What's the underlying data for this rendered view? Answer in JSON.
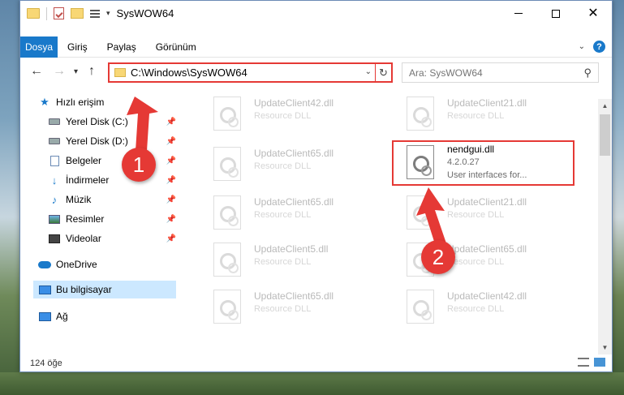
{
  "window": {
    "title": "SysWOW64"
  },
  "ribbon": {
    "tabs": [
      "Dosya",
      "Giriş",
      "Paylaş",
      "Görünüm"
    ]
  },
  "navigation": {
    "address": "C:\\Windows\\SysWOW64",
    "search_placeholder": "Ara: SysWOW64"
  },
  "sidebar": {
    "items": [
      {
        "label": "Hızlı erişim",
        "icon": "star-icon"
      },
      {
        "label": "Yerel Disk (C:)",
        "icon": "disk-icon",
        "pinned": true
      },
      {
        "label": "Yerel Disk (D:)",
        "icon": "disk-icon",
        "pinned": true
      },
      {
        "label": "Belgeler",
        "icon": "document-icon",
        "pinned": true
      },
      {
        "label": "İndirmeler",
        "icon": "download-icon",
        "pinned": true
      },
      {
        "label": "Müzik",
        "icon": "music-icon",
        "pinned": true
      },
      {
        "label": "Resimler",
        "icon": "picture-icon",
        "pinned": true
      },
      {
        "label": "Videolar",
        "icon": "video-icon",
        "pinned": true
      },
      {
        "label": "OneDrive",
        "icon": "cloud-icon"
      },
      {
        "label": "Bu bilgisayar",
        "icon": "computer-icon",
        "selected": true
      },
      {
        "label": "Ağ",
        "icon": "network-icon"
      }
    ]
  },
  "files": [
    {
      "name": "UpdateClient42.dll",
      "type": "Resource DLL"
    },
    {
      "name": "UpdateClient21.dll",
      "type": "Resource DLL"
    },
    {
      "name": "UpdateClient65.dll",
      "type": "Resource DLL"
    },
    {
      "name": "nendgui.dll",
      "version": "4.2.0.27",
      "description": "User interfaces for...",
      "highlighted": true
    },
    {
      "name": "UpdateClient65.dll",
      "type": "Resource DLL"
    },
    {
      "name": "UpdateClient21.dll",
      "type": "Resource DLL"
    },
    {
      "name": "UpdateClient5.dll",
      "type": "Resource DLL"
    },
    {
      "name": "UpdateClient65.dll",
      "type": "Resource DLL"
    },
    {
      "name": "UpdateClient65.dll",
      "type": "Resource DLL"
    },
    {
      "name": "UpdateClient42.dll",
      "type": "Resource DLL"
    }
  ],
  "status": {
    "count": "124 öğe"
  },
  "annotations": [
    {
      "number": "1"
    },
    {
      "number": "2"
    }
  ],
  "colors": {
    "accent": "#1979ca",
    "annotation": "#e53935",
    "selected_bg": "#cce8ff"
  }
}
